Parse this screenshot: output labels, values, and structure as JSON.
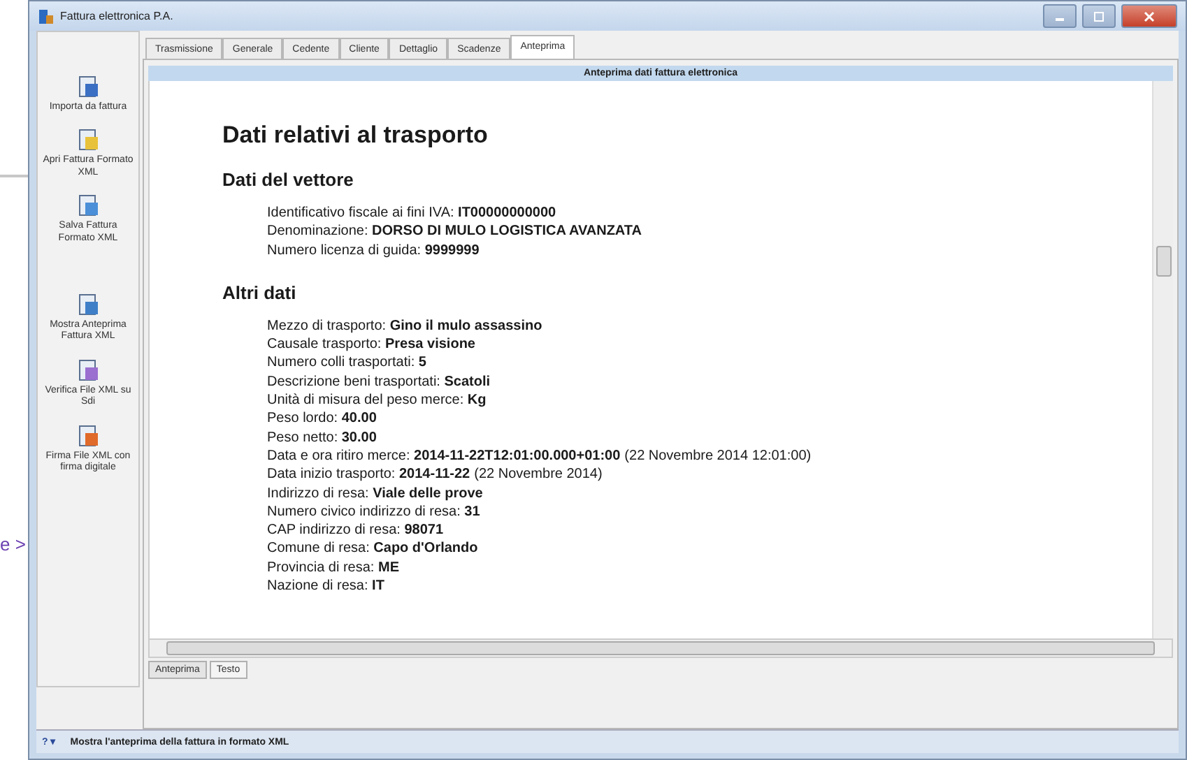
{
  "background_link": "e >",
  "window": {
    "title": "Fattura elettronica P.A."
  },
  "toolbar": [
    {
      "label": "Importa da fattura",
      "kind": "import"
    },
    {
      "label": "Apri Fattura Formato XML",
      "kind": "open"
    },
    {
      "label": "Salva Fattura Formato XML",
      "kind": "save"
    },
    {
      "label": "Mostra Anteprima Fattura XML",
      "kind": "preview"
    },
    {
      "label": "Verifica File XML su Sdi",
      "kind": "verify"
    },
    {
      "label": "Firma File XML con firma digitale",
      "kind": "sign"
    }
  ],
  "tabs": [
    {
      "label": "Trasmissione",
      "selected": false
    },
    {
      "label": "Generale",
      "selected": false
    },
    {
      "label": "Cedente",
      "selected": false
    },
    {
      "label": "Cliente",
      "selected": false
    },
    {
      "label": "Dettaglio",
      "selected": false
    },
    {
      "label": "Scadenze",
      "selected": false
    },
    {
      "label": "Anteprima",
      "selected": true
    }
  ],
  "panel_title": "Anteprima dati fattura elettronica",
  "document": {
    "title": "Dati relativi al trasporto",
    "sections": [
      {
        "title": "Dati del vettore",
        "rows": [
          {
            "label": "Identificativo fiscale ai fini IVA:",
            "value": "IT00000000000"
          },
          {
            "label": "Denominazione:",
            "value": "DORSO DI MULO LOGISTICA AVANZATA"
          },
          {
            "label": "Numero licenza di guida:",
            "value": "9999999"
          }
        ]
      },
      {
        "title": "Altri dati",
        "rows": [
          {
            "label": "Mezzo di trasporto:",
            "value": "Gino il mulo assassino"
          },
          {
            "label": "Causale trasporto:",
            "value": "Presa visione"
          },
          {
            "label": "Numero colli trasportati:",
            "value": "5"
          },
          {
            "label": "Descrizione beni trasportati:",
            "value": "Scatoli"
          },
          {
            "label": "Unità di misura del peso merce:",
            "value": "Kg"
          },
          {
            "label": "Peso lordo:",
            "value": "40.00"
          },
          {
            "label": "Peso netto:",
            "value": "30.00"
          },
          {
            "label": "Data e ora ritiro merce:",
            "value": "2014-11-22T12:01:00.000+01:00",
            "note": "(22 Novembre 2014 12:01:00)"
          },
          {
            "label": "Data inizio trasporto:",
            "value": "2014-11-22",
            "note": "(22 Novembre 2014)"
          },
          {
            "label": "Indirizzo di resa:",
            "value": "Viale delle prove"
          },
          {
            "label": "Numero civico indirizzo di resa:",
            "value": "31"
          },
          {
            "label": "CAP indirizzo di resa:",
            "value": "98071"
          },
          {
            "label": "Comune di resa:",
            "value": "Capo d'Orlando"
          },
          {
            "label": "Provincia di resa:",
            "value": "ME"
          },
          {
            "label": "Nazione di resa:",
            "value": "IT"
          }
        ]
      }
    ]
  },
  "view_tabs": [
    {
      "label": "Anteprima",
      "selected": true
    },
    {
      "label": "Testo",
      "selected": false
    }
  ],
  "status_bar": {
    "help": "? ▾",
    "message": "Mostra l'anteprima della fattura in formato XML"
  }
}
